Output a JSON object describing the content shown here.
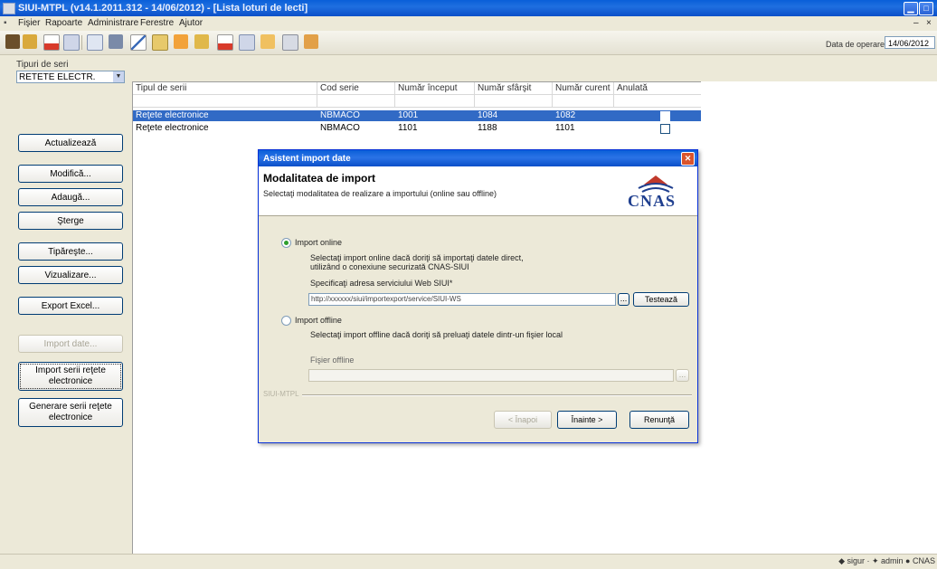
{
  "window": {
    "title": "SIUI-MTPL (v14.1.2011.312 - 14/06/2012) - [Lista loturi de lecti]"
  },
  "menu": [
    "Fişier",
    "Rapoarte",
    "Administrare",
    "Ferestre",
    "Ajutor"
  ],
  "toolbar": {
    "date_label": "Data de operare",
    "date_value": "14/06/2012"
  },
  "left": {
    "filter_label": "Tipuri de seri",
    "combo_value": "RETETE ELECTR.",
    "buttons": {
      "refresh": "Actualizează",
      "modify": "Modifică...",
      "add": "Adaugă...",
      "delete": "Şterge",
      "print": "Tipăreşte...",
      "view": "Vizualizare...",
      "export": "Export Excel...",
      "import_date": "Import date...",
      "import_series": "Import serii reţete electronice",
      "generate_series": "Generare serii reţete electronice"
    }
  },
  "grid": {
    "columns": [
      "Tipul de serii",
      "Cod serie",
      "Număr început",
      "Număr sfârşit",
      "Număr curent",
      "Anulată"
    ],
    "rows": [
      {
        "type": "Reţete electronice",
        "code": "NBMACO",
        "start": "1001",
        "end": "1084",
        "current": "1082",
        "cancelled": true
      },
      {
        "type": "Reţete electronice",
        "code": "NBMACO",
        "start": "1101",
        "end": "1188",
        "current": "1101",
        "cancelled": false
      }
    ]
  },
  "dialog": {
    "title": "Asistent import date",
    "heading": "Modalitatea de import",
    "subheading": "Selectaţi modalitatea de realizare a importului (online sau offline)",
    "logo_text": "CNAS",
    "online": {
      "label": "Import online",
      "desc1": "Selectaţi import online dacă doriţi să importaţi datele direct,",
      "desc2": "utilizând o conexiune securizată CNAS-SIUI",
      "addr_label": "Specificaţi adresa serviciului Web SIUI*",
      "url": "http://xxxxxx/siui/importexport/service/SIUI-WS",
      "test_button": "Testează",
      "browse": "..."
    },
    "offline": {
      "label": "Import offline",
      "desc": "Selectaţi import offline dacă doriţi să preluaţi datele dintr-un fişier local",
      "file_label": "Fişier offline",
      "browse": "..."
    },
    "footer_label": "SIUI-MTPL",
    "buttons": {
      "back": "< Înapoi",
      "next": "Înainte >",
      "cancel": "Renunţă"
    }
  },
  "status": {
    "text": "◆ sigur · ✦ admin ● CNAS"
  }
}
